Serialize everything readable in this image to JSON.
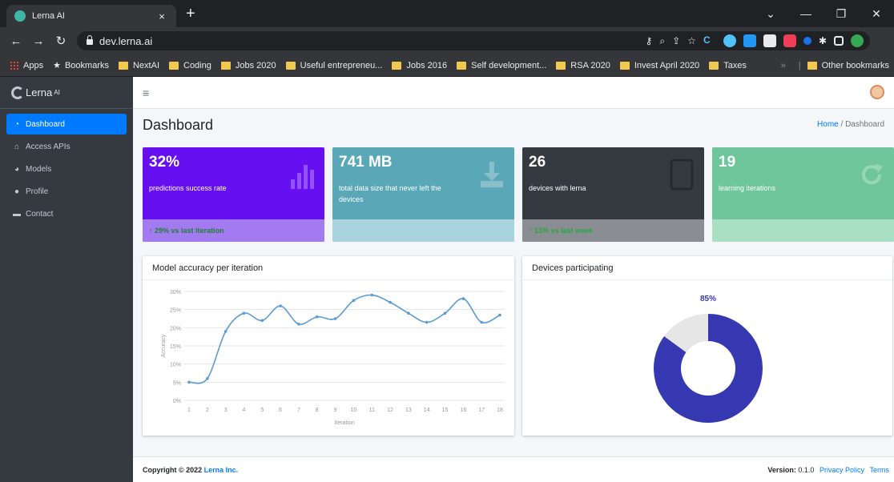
{
  "browser": {
    "tab_title": "Lerna AI",
    "tab_close": "×",
    "new_tab": "+",
    "url": "dev.lerna.ai",
    "bookmarks": [
      {
        "label": "Apps",
        "icon": "apps-grid-icon"
      },
      {
        "label": "Bookmarks",
        "icon": "star-icon"
      },
      {
        "label": "NextAI",
        "icon": "folder-icon"
      },
      {
        "label": "Coding",
        "icon": "folder-icon"
      },
      {
        "label": "Jobs 2020",
        "icon": "folder-icon"
      },
      {
        "label": "Useful entrepreneu...",
        "icon": "folder-icon"
      },
      {
        "label": "Jobs 2016",
        "icon": "folder-icon"
      },
      {
        "label": "Self development...",
        "icon": "folder-icon"
      },
      {
        "label": "RSA 2020",
        "icon": "folder-icon"
      },
      {
        "label": "Invest April 2020",
        "icon": "folder-icon"
      },
      {
        "label": "Taxes",
        "icon": "folder-icon"
      }
    ],
    "overflow": "»",
    "other_bookmarks": "Other bookmarks",
    "colors": {
      "tabstrip": "#202124",
      "toolbar": "#35363a"
    }
  },
  "sidebar": {
    "brand": "Lerna",
    "brand_sup": "AI",
    "items": [
      {
        "label": "Dashboard",
        "icon": "tachometer-icon",
        "active": true
      },
      {
        "label": "Access APIs",
        "icon": "network-icon",
        "active": false
      },
      {
        "label": "Models",
        "icon": "chart-icon",
        "active": false
      },
      {
        "label": "Profile",
        "icon": "user-icon",
        "active": false
      },
      {
        "label": "Contact",
        "icon": "comment-icon",
        "active": false
      }
    ]
  },
  "header": {
    "title": "Dashboard",
    "breadcrumb_home": "Home",
    "breadcrumb_sep": "/",
    "breadcrumb_current": "Dashboard"
  },
  "cards": [
    {
      "value": "32%",
      "desc": "predictions success rate",
      "footer": "↑ 29% vs last iteration",
      "color": "#6610f2",
      "footer_color": "#a37bf0",
      "icon": "bar-chart-icon"
    },
    {
      "value": "741 MB",
      "desc": "total data size that never left the devices",
      "footer": "",
      "color": "#5aa7b8",
      "footer_color": "#a8d3dc",
      "icon": "download-icon"
    },
    {
      "value": "26",
      "desc": "devices with lerna",
      "footer": "↑ 13% vs last week",
      "color": "#343a40",
      "footer_color": "#8a8d91",
      "icon": "tablet-icon"
    },
    {
      "value": "19",
      "desc": "learning iterations",
      "footer": "",
      "color": "#6fc69a",
      "footer_color": "#a9e0c3",
      "icon": "refresh-icon"
    }
  ],
  "accuracy_panel": {
    "title": "Model accuracy per iteration"
  },
  "devices_panel": {
    "title": "Devices participating"
  },
  "chart_data": [
    {
      "type": "line",
      "title": "Model accuracy per iteration",
      "xlabel": "Iteration",
      "ylabel": "Accuracy",
      "x": [
        1,
        2,
        3,
        4,
        5,
        6,
        7,
        8,
        9,
        10,
        11,
        12,
        13,
        14,
        15,
        16,
        17,
        18
      ],
      "y_ticks": [
        "0%",
        "5%",
        "10%",
        "15%",
        "20%",
        "25%",
        "30%"
      ],
      "ylim": [
        0,
        30
      ],
      "series": [
        {
          "values": [
            5,
            6,
            19,
            24,
            22,
            26,
            21,
            23,
            22.5,
            27.5,
            29,
            27,
            24,
            21.5,
            24,
            28,
            21.5,
            23.5
          ],
          "color": "#5b9bd5"
        }
      ],
      "grid": true
    },
    {
      "type": "pie",
      "title": "Devices participating",
      "label": "85%",
      "slices": [
        {
          "value": 85,
          "color": "#3538b0"
        },
        {
          "value": 15,
          "color": "#e6e6e6"
        }
      ]
    }
  ],
  "footer": {
    "copyright": "Copyright © 2022 ",
    "company": "Lerna Inc.",
    "version_label": "Version:",
    "version": "0.1.0",
    "privacy": "Privacy Policy",
    "terms": "Terms"
  }
}
